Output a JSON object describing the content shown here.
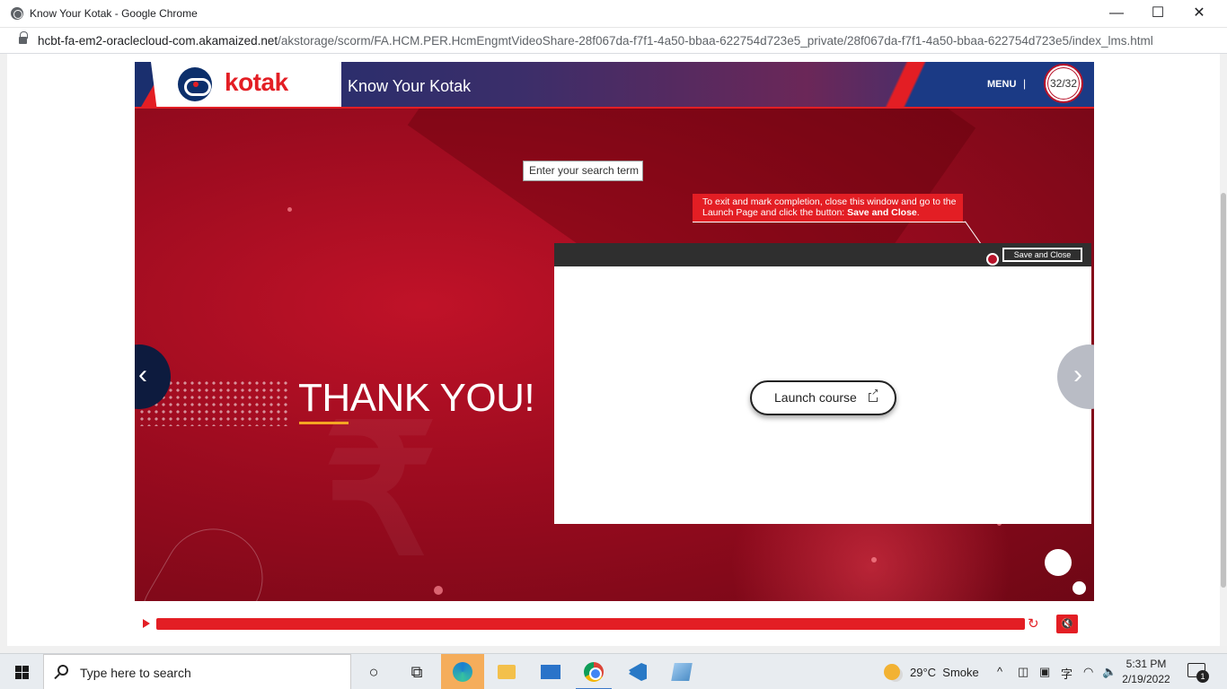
{
  "window": {
    "title": "Know Your Kotak - Google Chrome",
    "minimize": "—",
    "maximize": "☐",
    "close": "✕"
  },
  "address": {
    "host": "hcbt-fa-em2-oraclecloud-com.akamaized.net",
    "path": "/akstorage/scorm/FA.HCM.PER.HcmEngmtVideoShare-28f067da-f7f1-4a50-bbaa-622754d723e5_private/28f067da-f7f1-4a50-bbaa-622754d723e5/index_lms.html"
  },
  "course": {
    "logo_text": "kotak",
    "title": "Know Your Kotak",
    "menu_label": "MENU",
    "menu_sep": "|",
    "slide_counter": "32/32",
    "search_placeholder": "Enter your search term",
    "tooltip_text": "To exit and mark completion, close this window and go to the Launch Page and click the button:",
    "tooltip_bold": "Save and Close",
    "tooltip_period": ".",
    "save_close_label": "Save and Close",
    "launch_label": "Launch course",
    "thank_you": "THANK YOU!",
    "prev_icon": "‹",
    "next_icon": "›",
    "progress_fraction": 1.0,
    "replay_icon": "↻",
    "mute_icon": "🔇"
  },
  "taskbar": {
    "search_placeholder": "Type here to search",
    "weather_temp": "29°C",
    "weather_desc": "Smoke",
    "time": "5:31 PM",
    "date": "2/19/2022",
    "notification_count": "1",
    "task_view_icon": "task-view-icon",
    "colors": {
      "accent": "#e31e24",
      "taskbar_active": "#f5ad5b"
    }
  }
}
